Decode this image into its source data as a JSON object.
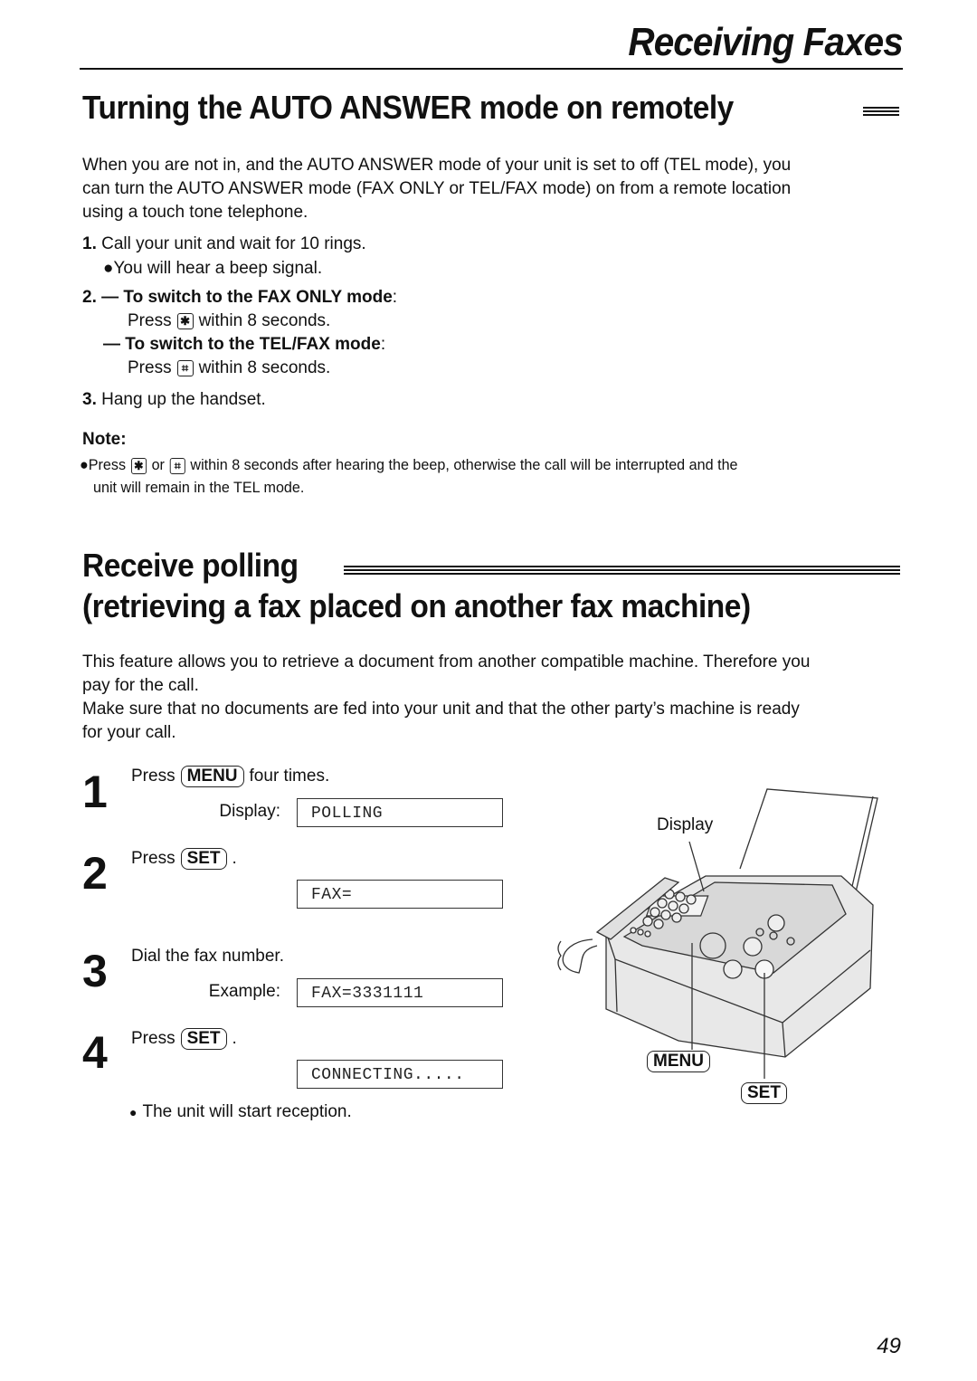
{
  "header": {
    "running_title": "Receiving Faxes"
  },
  "section1": {
    "title": "Turning the AUTO ANSWER mode on remotely",
    "intro": [
      "When you are not in, and the AUTO ANSWER mode of your unit is set to off (TEL mode), you",
      "can turn the AUTO ANSWER mode (FAX ONLY or TEL/FAX mode) on from a remote location",
      "using a touch tone telephone."
    ],
    "steps": {
      "s1_num": "1.",
      "s1_text": "Call your unit and wait for 10 rings.",
      "s1_bullet": "You will hear a beep signal.",
      "s2_num": "2.",
      "dash": "—",
      "s2a_heading": "To switch to the FAX ONLY mode",
      "s2a_press": "Press",
      "s2a_key": "✱",
      "s2a_after": "within 8 seconds.",
      "s2b_heading": "To switch to the TEL/FAX mode",
      "s2b_press": "Press",
      "s2b_key": "⌗",
      "s2b_after": "within 8 seconds.",
      "s3_num": "3.",
      "s3_text": "Hang up the handset."
    },
    "note": {
      "label": "Note:",
      "press": "Press",
      "key1": "✱",
      "or": "or",
      "key2": "⌗",
      "text1": "within 8 seconds after hearing the beep, otherwise the call will be interrupted and the",
      "text2": "unit will remain in the TEL mode."
    }
  },
  "section2": {
    "title_line1": "Receive polling",
    "title_line2": "(retrieving a fax placed on another fax machine)",
    "intro": [
      "This feature allows you to retrieve a document from another compatible machine. Therefore you",
      "pay for the call.",
      "Make sure that no documents are fed into your unit and that the other party’s machine is ready",
      "for your call."
    ],
    "steps": [
      {
        "num": "1",
        "text_before": "Press",
        "key": "MENU",
        "text_after": "four times.",
        "lcd_label": "Display:",
        "lcd": "POLLING"
      },
      {
        "num": "2",
        "text_before": "Press",
        "key": "SET",
        "text_after": ".",
        "lcd_label": "",
        "lcd": "FAX="
      },
      {
        "num": "3",
        "text": "Dial the fax number.",
        "lcd_label": "Example:",
        "lcd": "FAX=3331111"
      },
      {
        "num": "4",
        "text_before": "Press",
        "key": "SET",
        "text_after": ".",
        "lcd_label": "",
        "lcd": "CONNECTING....."
      }
    ],
    "final_bullet": "The unit will start reception.",
    "illustration": {
      "display_label": "Display",
      "menu_label": "MENU",
      "set_label": "SET"
    }
  },
  "footer": {
    "page_number": "49"
  }
}
